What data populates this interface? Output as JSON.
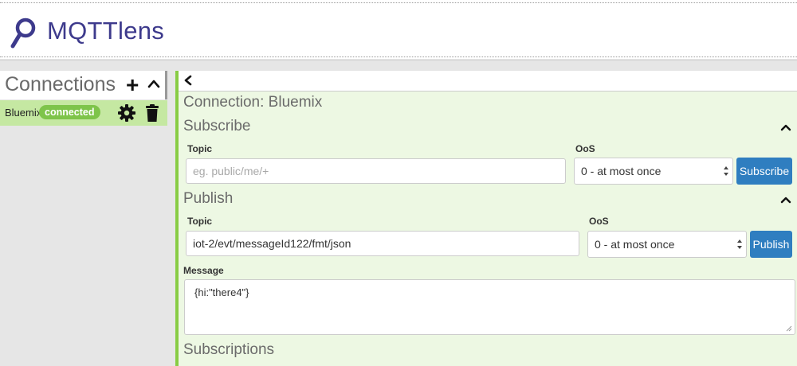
{
  "app": {
    "title": "MQTTlens"
  },
  "connections": {
    "title": "Connections",
    "add_label": "+",
    "items": [
      {
        "name": "Bluemix",
        "status": "connected"
      }
    ]
  },
  "panel": {
    "connection_title": "Connection: Bluemix",
    "subscribe": {
      "title": "Subscribe",
      "topic_label": "Topic",
      "topic_placeholder": "eg. public/me/+",
      "qos_label": "OoS",
      "qos_value": "0 - at most once",
      "button_label": "Subscribe"
    },
    "publish": {
      "title": "Publish",
      "topic_label": "Topic",
      "topic_value": "iot-2/evt/messageId122/fmt/json",
      "qos_label": "OoS",
      "qos_value": "0 - at most once",
      "button_label": "Publish",
      "message_label": "Message",
      "message_value": "{hi:\"there4\"}"
    },
    "subscriptions_title": "Subscriptions"
  },
  "colors": {
    "accent": "#88cc44",
    "badge": "#7ec44a",
    "button": "#2f7ec0",
    "brand": "#3d3a8c"
  }
}
